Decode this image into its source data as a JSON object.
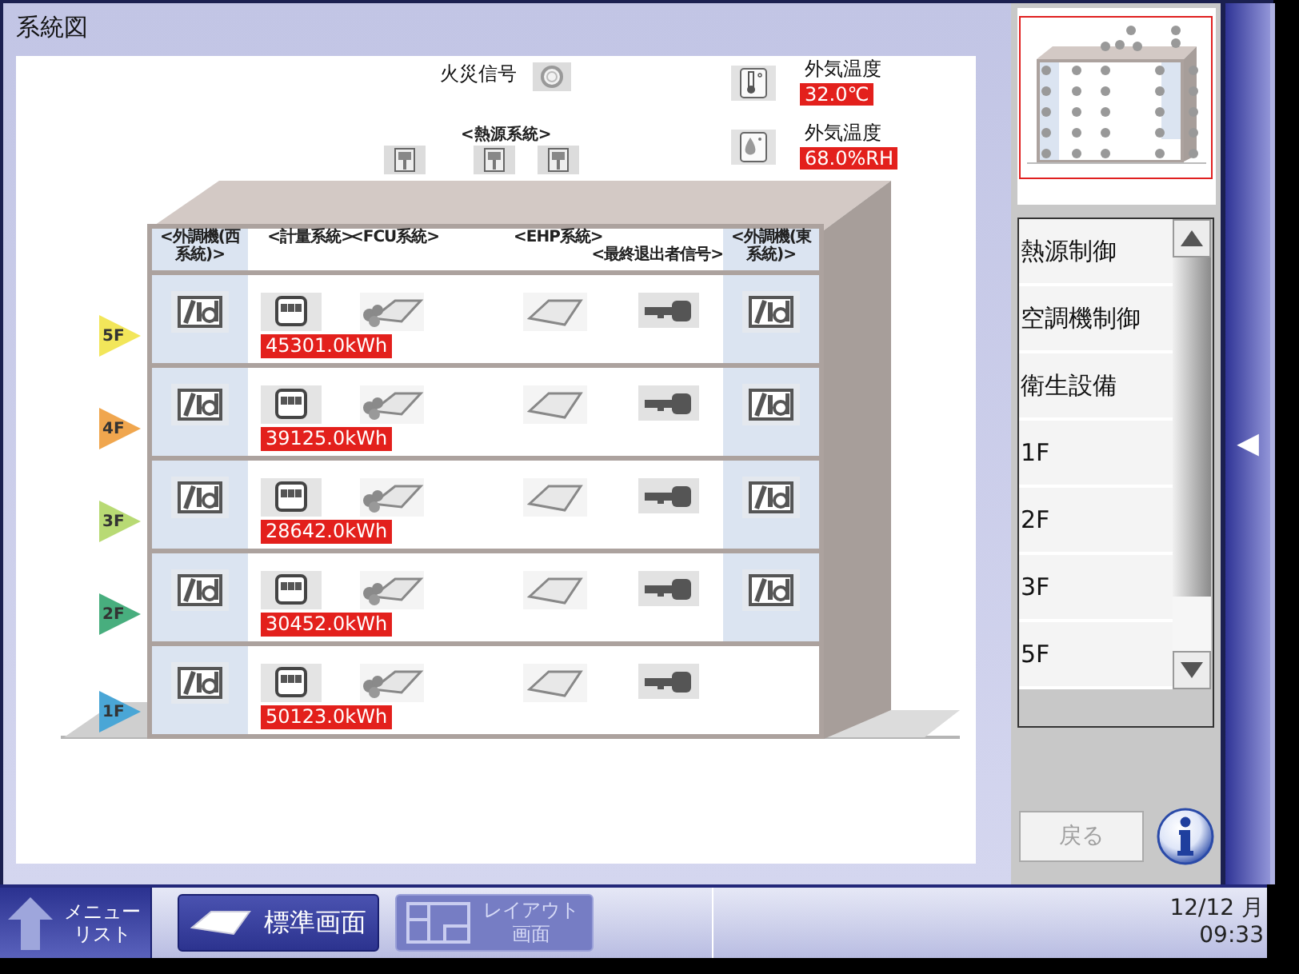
{
  "title": "系統図",
  "fire_signal": {
    "label": "火災信号"
  },
  "heat_source": {
    "label": "<熱源系統>"
  },
  "sensors": [
    {
      "kind": "temperature",
      "label": "外気温度",
      "value": "32.0℃"
    },
    {
      "kind": "humidity",
      "label": "外気温度",
      "value": "68.0%RH"
    }
  ],
  "columns": [
    "<外調機(西系統)>",
    "<計量系統>",
    "<FCU系統>",
    "<EHP系統>",
    "<最終退出者信号>",
    "<外調機(東系統)>"
  ],
  "floors": [
    {
      "label": "5F",
      "color": "#f2e65a",
      "energy": "45301.0kWh",
      "east_unit": true
    },
    {
      "label": "4F",
      "color": "#f0a64e",
      "energy": "39125.0kWh",
      "east_unit": true
    },
    {
      "label": "3F",
      "color": "#b8da74",
      "energy": "28642.0kWh",
      "east_unit": true
    },
    {
      "label": "2F",
      "color": "#48ae7e",
      "energy": "30452.0kWh",
      "east_unit": true
    },
    {
      "label": "1F",
      "color": "#4aa6d6",
      "energy": "50123.0kWh",
      "east_unit": false
    }
  ],
  "side_menu": [
    {
      "label": "熱源制御"
    },
    {
      "label": "空調機制御"
    },
    {
      "label": "衛生設備"
    },
    {
      "label": "1F"
    },
    {
      "label": "2F"
    },
    {
      "label": "3F"
    },
    {
      "label": "5F"
    }
  ],
  "back_button": {
    "label": "戻る",
    "disabled": true
  },
  "collapse_handle": "◀",
  "taskbar": {
    "menu_button": [
      "メニュー",
      "リスト"
    ],
    "buttons": [
      {
        "kind": "standard",
        "label": "標準画面",
        "disabled": false
      },
      {
        "kind": "layout",
        "label": [
          "レイアウト",
          "画面"
        ],
        "disabled": true
      }
    ],
    "date": "12/12 月",
    "time": "09:33"
  }
}
